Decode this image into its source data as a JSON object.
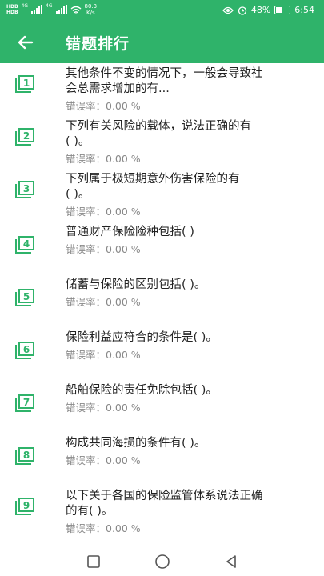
{
  "status_bar": {
    "sim1": "HD",
    "sim1_sub": "B",
    "sim2": "HD",
    "sim2_sub": "B",
    "net1": "4G",
    "net2": "4G",
    "speed_value": "80.3",
    "speed_unit": "K/s",
    "battery": "48%",
    "battery_level": 0.48,
    "time": "6:54",
    "icons": [
      "eye-icon",
      "alarm-icon",
      "battery-icon",
      "wifi-icon",
      "signal-icon"
    ]
  },
  "app_bar": {
    "title": "错题排行",
    "back_icon": "back-arrow-icon",
    "color": "#2fb36a"
  },
  "accent_color": "#2fb36a",
  "items": [
    {
      "num": "1",
      "line1": "其他条件不变的情况下，一般会导致社",
      "line2": "会总需求增加的有...",
      "rate": "错误率：0.00 %"
    },
    {
      "num": "2",
      "line1": "下列有关风险的载体，说法正确的有",
      "line2": "( )。",
      "rate": "错误率：0.00 %"
    },
    {
      "num": "3",
      "line1": "下列属于极短期意外伤害保险的有",
      "line2": "( )。",
      "rate": "错误率：0.00 %"
    },
    {
      "num": "4",
      "line1": "普通财产保险险种包括( )",
      "line2": "",
      "rate": "错误率：0.00 %"
    },
    {
      "num": "5",
      "line1": "储蓄与保险的区别包括( )。",
      "line2": "",
      "rate": "错误率：0.00 %"
    },
    {
      "num": "6",
      "line1": "保险利益应符合的条件是( )。",
      "line2": "",
      "rate": "错误率：0.00 %"
    },
    {
      "num": "7",
      "line1": "船舶保险的责任免除包括( )。",
      "line2": "",
      "rate": "错误率：0.00 %"
    },
    {
      "num": "8",
      "line1": "构成共同海损的条件有( )。",
      "line2": "",
      "rate": "错误率：0.00 %"
    },
    {
      "num": "9",
      "line1": "以下关于各国的保险监管体系说法正确",
      "line2": "的有( )。",
      "rate": "错误率：0.00 %"
    }
  ],
  "nav_bar": {
    "icons": [
      "recents-square-icon",
      "home-circle-icon",
      "back-triangle-icon"
    ]
  }
}
